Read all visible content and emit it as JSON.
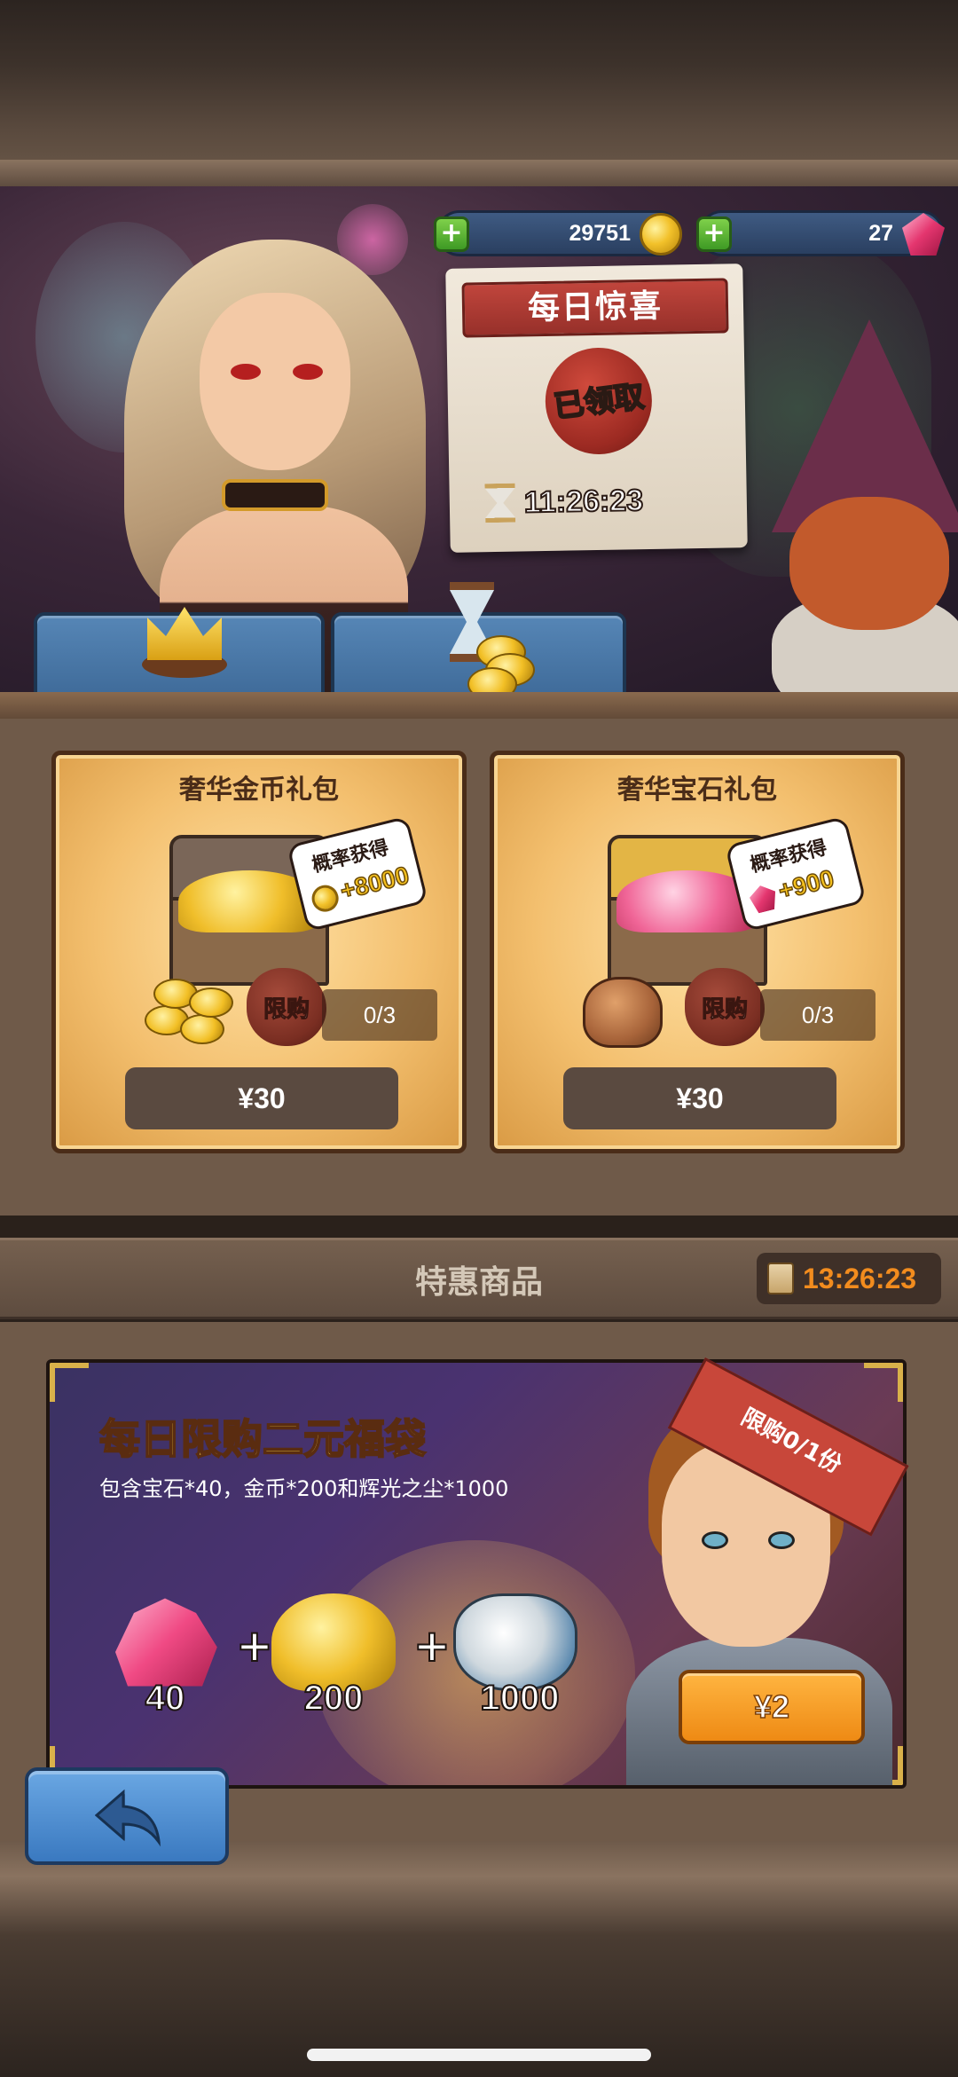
{
  "currency": {
    "gold": "29751",
    "gems": "27",
    "plus": "+"
  },
  "daily_surprise": {
    "title": "每日惊喜",
    "status": "已领取",
    "timer": "11:26:23"
  },
  "packs": [
    {
      "title": "奢华金币礼包",
      "chance_label": "概率获得",
      "bonus": "+8000",
      "limit_label": "限购",
      "count": "0/3",
      "price": "¥30"
    },
    {
      "title": "奢华宝石礼包",
      "chance_label": "概率获得",
      "bonus": "+900",
      "limit_label": "限购",
      "count": "0/3",
      "price": "¥30"
    }
  ],
  "special_offers": {
    "title": "特惠商品",
    "timer": "13:26:23"
  },
  "lucky_bag": {
    "title": "每日限购二元福袋",
    "description": "包含宝石*40，金币*200和辉光之尘*1000",
    "ribbon": "限购0/1份",
    "rewards": [
      {
        "icon": "gem-pile-icon",
        "qty": "40"
      },
      {
        "icon": "gold-pile-icon",
        "qty": "200"
      },
      {
        "icon": "dust-jar-icon",
        "qty": "1000"
      }
    ],
    "plus": "+",
    "price": "¥2"
  },
  "colors": {
    "accent_orange": "#f28c1e",
    "button_blue": "#3a79c0",
    "gold_text": "#ffd84a"
  }
}
